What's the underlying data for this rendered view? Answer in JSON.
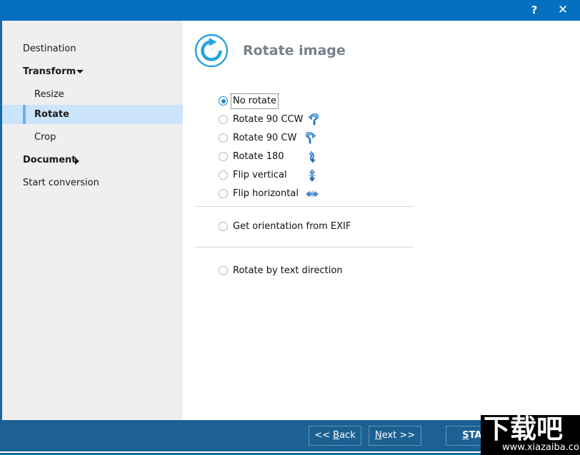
{
  "titlebar": {
    "title": "",
    "help_icon": "question-mark-icon",
    "help_label": "?",
    "close_icon": "close-icon",
    "close_label": "✕",
    "background": "#0270bf"
  },
  "sidebar": {
    "background": "#efefef",
    "selection_background": "#cce4fb",
    "selection_accent": "#6cb1ec",
    "items": [
      {
        "label": "Destination",
        "level": "top",
        "bold": false,
        "selected": false,
        "chevron": "none"
      },
      {
        "label": "Transform",
        "level": "top",
        "bold": true,
        "selected": false,
        "chevron": "down"
      },
      {
        "label": "Resize",
        "level": "sub",
        "bold": false,
        "selected": false,
        "chevron": "none"
      },
      {
        "label": "Rotate",
        "level": "sub",
        "bold": true,
        "selected": true,
        "chevron": "none"
      },
      {
        "label": "Crop",
        "level": "sub",
        "bold": false,
        "selected": false,
        "chevron": "none"
      },
      {
        "label": "Document",
        "level": "top",
        "bold": true,
        "selected": false,
        "chevron": "right"
      },
      {
        "label": "Start conversion",
        "level": "top",
        "bold": false,
        "selected": false,
        "chevron": "none"
      }
    ]
  },
  "main": {
    "header": {
      "icon": "rotate-clockwise-circle-icon",
      "title": "Rotate image",
      "title_color": "#77818c",
      "icon_color": "#29a3dc"
    },
    "rotate_options": [
      {
        "label": "No rotate",
        "selected": true,
        "focused": true,
        "icon": "none"
      },
      {
        "label": "Rotate 90 CCW",
        "selected": false,
        "focused": false,
        "icon": "rotate-ccw-icon"
      },
      {
        "label": "Rotate 90 CW",
        "selected": false,
        "focused": false,
        "icon": "rotate-cw-icon"
      },
      {
        "label": "Rotate 180",
        "selected": false,
        "focused": false,
        "icon": "rotate-180-icon"
      },
      {
        "label": "Flip vertical",
        "selected": false,
        "focused": false,
        "icon": "flip-vertical-icon"
      },
      {
        "label": "Flip horizontal",
        "selected": false,
        "focused": false,
        "icon": "flip-horizontal-icon"
      }
    ],
    "exif_option": {
      "label": "Get orientation from EXIF",
      "selected": false
    },
    "text_direction_option": {
      "label": "Rotate by text direction",
      "selected": false
    }
  },
  "footer": {
    "background": "#1c6192",
    "buttons": [
      {
        "name": "back",
        "prefix": "<< ",
        "mnemonic": "B",
        "suffix": "ack",
        "primary": false
      },
      {
        "name": "next",
        "prefix": "",
        "mnemonic": "N",
        "suffix": "ext >>",
        "primary": false
      },
      {
        "name": "start",
        "prefix": "",
        "mnemonic": "S",
        "suffix": "TART",
        "primary": true
      }
    ]
  },
  "watermark": {
    "cjk": "下载吧",
    "url": "www.xiazaiba.com"
  }
}
